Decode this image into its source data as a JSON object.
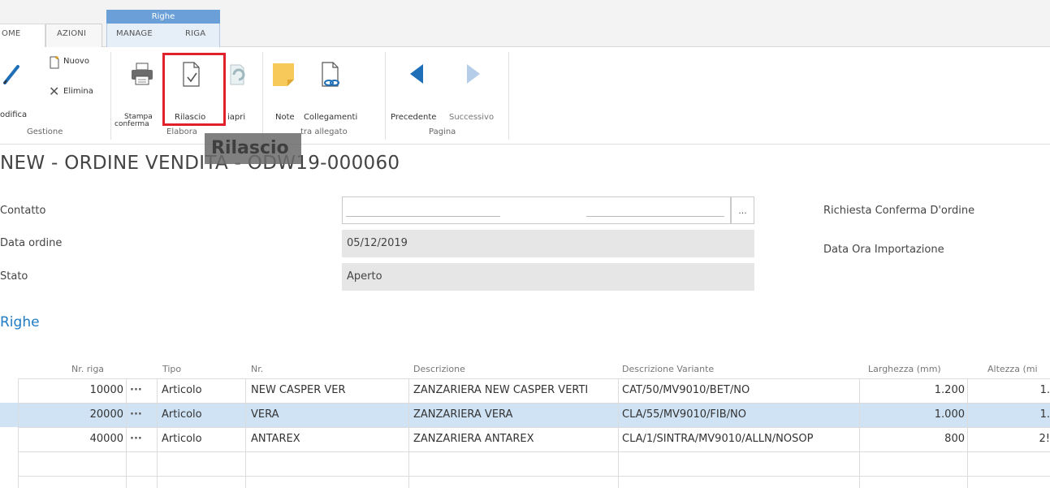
{
  "ribbon": {
    "contextual_group": "Righe",
    "tabs": [
      "OME",
      "AZIONI",
      "MANAGE",
      "RIGA"
    ],
    "buttons": {
      "modifica": "odifica",
      "nuovo": "Nuovo",
      "elimina": "Elimina",
      "stampa_line1": "Stampa",
      "stampa_line2": "conferma",
      "rilascio": "Rilascio",
      "riapri": "iapri",
      "note": "Note",
      "collegamenti": "Collegamenti",
      "precedente": "Precedente",
      "successivo": "Successivo"
    },
    "groups": {
      "gestione": "Gestione",
      "elabora": "Elabora",
      "allegato": "tra allegato",
      "pagina": "Pagina"
    },
    "tooltip": "Rilascio"
  },
  "page": {
    "title": "NEW - ORDINE VENDITA - ODW19-000060"
  },
  "form": {
    "contatto_label": "Contatto",
    "data_ordine_label": "Data ordine",
    "data_ordine_value": "05/12/2019",
    "stato_label": "Stato",
    "stato_value": "Aperto",
    "lookup": "...",
    "richiesta_label": "Richiesta Conferma D'ordine",
    "importazione_label": "Data Ora Importazione"
  },
  "lines": {
    "section_title": "Righe",
    "columns": [
      "Nr. riga",
      "Tipo",
      "Nr.",
      "Descrizione",
      "Descrizione Variante",
      "Larghezza (mm)",
      "Altezza (mi"
    ],
    "rows": [
      {
        "nr_riga": "10000",
        "menu": "···",
        "tipo": "Articolo",
        "nr": "NEW CASPER VER",
        "descrizione": "ZANZARIERA NEW CASPER VERTI",
        "variante": "CAT/50/MV9010/BET/NO",
        "larghezza": "1.200",
        "altezza": "1."
      },
      {
        "nr_riga": "20000",
        "menu": "···",
        "tipo": "Articolo",
        "nr": "VERA",
        "descrizione": "ZANZARIERA VERA",
        "variante": "CLA/55/MV9010/FIB/NO",
        "larghezza": "1.000",
        "altezza": "1."
      },
      {
        "nr_riga": "40000",
        "menu": "···",
        "tipo": "Articolo",
        "nr": "ANTAREX",
        "descrizione": "ZANZARIERA ANTAREX",
        "variante": "CLA/1/SINTRA/MV9010/ALLN/NOSOP",
        "larghezza": "800",
        "altezza": "2!"
      }
    ]
  },
  "colors": {
    "accent": "#1e7bc4",
    "contextual_tab": "#6a9fd8",
    "highlight_box": "#e0202a",
    "selected_row": "#cfe3f4",
    "readonly_field": "#e6e6e6"
  }
}
